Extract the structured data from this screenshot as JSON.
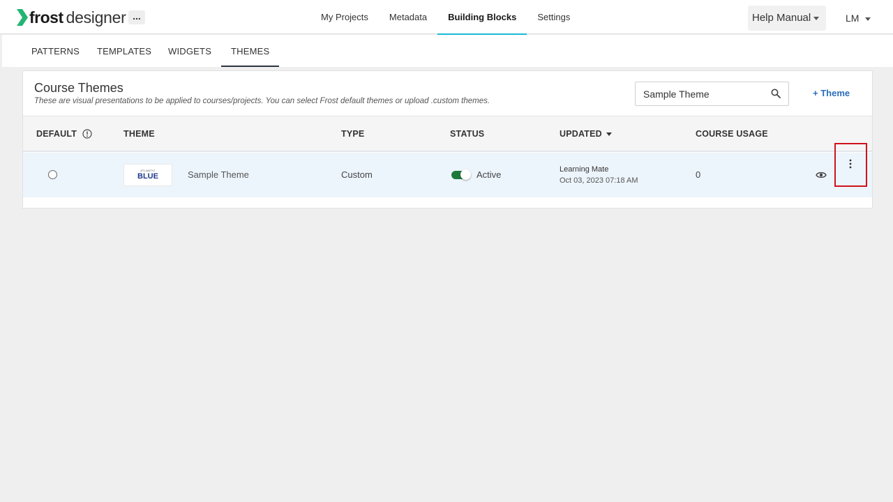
{
  "brand": {
    "name_bold": "frost",
    "name_light": "designer",
    "more": "..."
  },
  "nav": {
    "items": [
      "My Projects",
      "Metadata",
      "Building Blocks",
      "Settings"
    ],
    "active": "Building Blocks"
  },
  "header": {
    "help_label": "Help Manual",
    "user_initials": "LM"
  },
  "subtabs": {
    "items": [
      "PATTERNS",
      "TEMPLATES",
      "WIDGETS",
      "THEMES"
    ],
    "active": "THEMES"
  },
  "card": {
    "title": "Course Themes",
    "subtitle": "These are visual presentations to be applied to courses/projects. You can select Frost default themes or upload .custom themes.",
    "search_value": "Sample Theme",
    "add_label": "+ Theme"
  },
  "table": {
    "columns": [
      "DEFAULT",
      "THEME",
      "TYPE",
      "STATUS",
      "UPDATED",
      "COURSE USAGE"
    ],
    "rows": [
      {
        "thumb_small": "ATLANTIC",
        "thumb_big": "BLUE",
        "theme": "Sample Theme",
        "type": "Custom",
        "status": "Active",
        "updated_by": "Learning Mate",
        "updated_at": "Oct 03, 2023 07:18 AM",
        "course_usage": "0"
      }
    ]
  },
  "colors": {
    "accent": "#19b8d6",
    "link": "#2a6ebb",
    "toggle_on": "#1f7a3a",
    "highlight": "#d0121b",
    "row_bg": "#edf5fc"
  },
  "icons": [
    "logo-chevron-icon",
    "search-icon",
    "info-icon",
    "eye-icon",
    "kebab-menu-icon",
    "caret-down-icon"
  ]
}
